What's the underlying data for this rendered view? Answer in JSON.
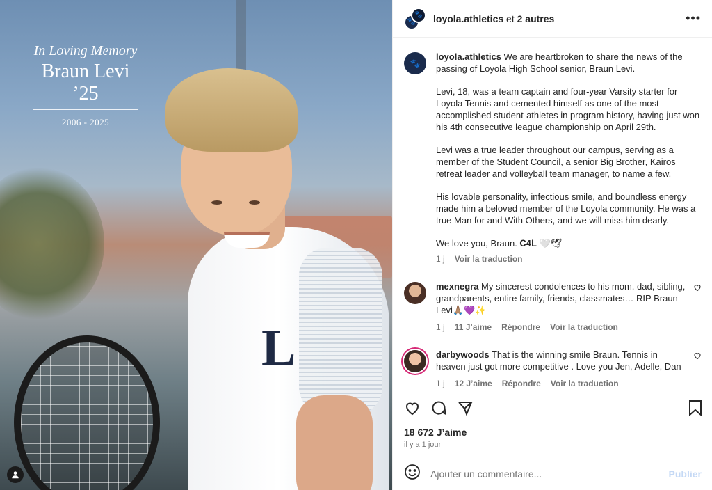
{
  "photo": {
    "memorial_line": "In Loving Memory",
    "memorial_name": "Braun Levi ’25",
    "memorial_years": "2006 - 2025",
    "shirt_letter": "L"
  },
  "header": {
    "username": "loyola.athletics",
    "joiner": " et ",
    "others": "2 autres"
  },
  "caption": {
    "username": "loyola.athletics",
    "paragraphs": [
      "We are heartbroken to share the news of the passing of Loyola High School senior, Braun Levi.",
      "Levi, 18, was a team captain and four-year Varsity starter for Loyola Tennis and cemented himself as one of the most accomplished student-athletes in program history, having just won his 4th consecutive league championship on April 29th.",
      "Levi was a true leader throughout our campus, serving as a member of the Student Council, a senior Big Brother, Kairos retreat leader and volleyball team manager, to name a few.",
      "His lovable personality, infectious smile, and boundless energy made him a beloved member of the Loyola community. He was a true Man for and With Others, and we will miss him dearly.",
      "We love you, Braun. 𝐂𝟒𝐋 🤍🕊"
    ],
    "time": "1 j",
    "translate": "Voir la traduction"
  },
  "comments": [
    {
      "username": "mexnegra",
      "text": "My sincerest condolences to his mom, dad, sibling, grandparents, entire family, friends, classmates… RIP Braun Levi🙏🏽💜✨",
      "time": "1 j",
      "likes": "11 J’aime",
      "reply": "Répondre",
      "translate": "Voir la traduction"
    },
    {
      "username": "darbywoods",
      "text": "That is the winning smile Braun. Tennis in heaven just got more competitive . Love you Jen, Adelle, Dan",
      "time": "1 j",
      "likes": "12 J’aime",
      "reply": "Répondre",
      "translate": "Voir la traduction"
    }
  ],
  "post": {
    "likes": "18 672 J’aime",
    "ago": "il y a 1 jour"
  },
  "composer": {
    "placeholder": "Ajouter un commentaire...",
    "publish": "Publier"
  },
  "colors": {
    "brand_navy": "#1a2b4c",
    "publish_disabled": "#c5d9f5"
  },
  "icons": [
    "more-icon",
    "heart-icon",
    "comment-icon",
    "share-icon",
    "bookmark-icon",
    "emoji-icon",
    "user-tag-icon"
  ]
}
